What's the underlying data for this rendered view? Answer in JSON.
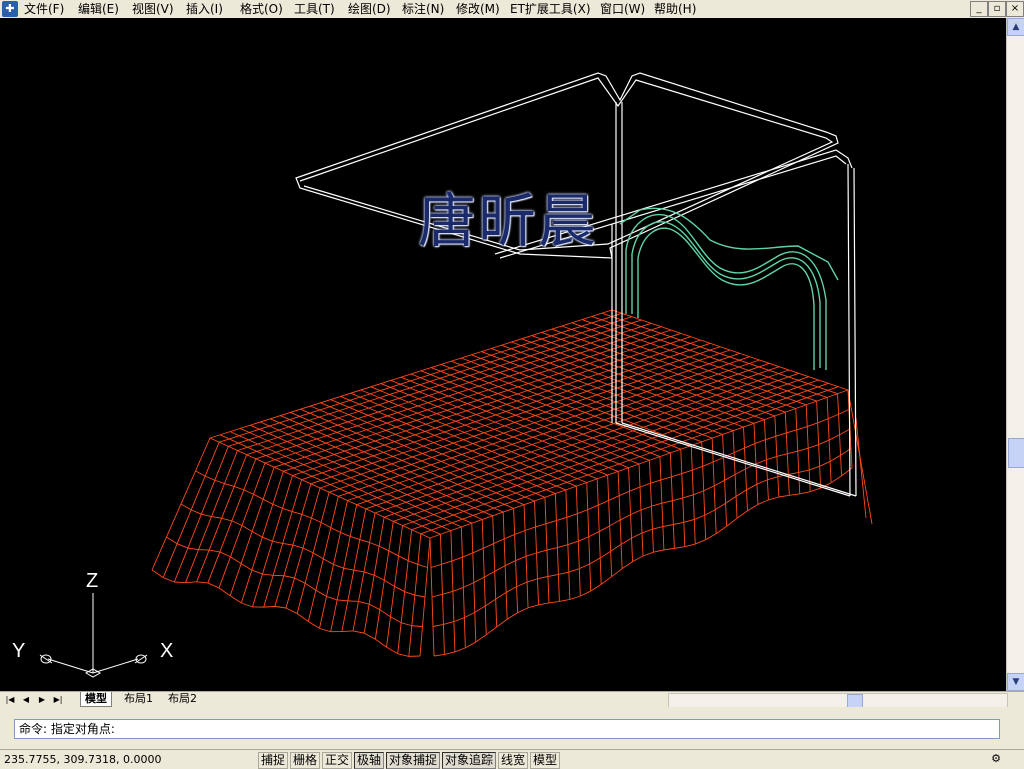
{
  "menubar": {
    "items": [
      "文件(F)",
      "编辑(E)",
      "视图(V)",
      "插入(I)",
      "格式(O)",
      "工具(T)",
      "绘图(D)",
      "标注(N)",
      "修改(M)",
      "ET扩展工具(X)",
      "窗口(W)",
      "帮助(H)"
    ]
  },
  "window_controls": {
    "minimize": "_",
    "restore": "▫",
    "close": "×"
  },
  "canvas": {
    "title_text": "唐昕晨",
    "ucs": {
      "x": "X",
      "y": "Y",
      "z": "Z"
    },
    "colors": {
      "background": "#000000",
      "mesh": "#ff4a1a",
      "frame": "#ffffff",
      "headboard": "#5fd3a6"
    }
  },
  "layout_tabs": [
    "模型",
    "布局1",
    "布局2"
  ],
  "command": {
    "prompt": "命令:  指定对角点:"
  },
  "status": {
    "coords": "235.7755,  309.7318,  0.0000",
    "toggles": [
      "捕捉",
      "栅格",
      "正交",
      "极轴",
      "对象捕捉",
      "对象追踪",
      "线宽",
      "模型"
    ]
  }
}
